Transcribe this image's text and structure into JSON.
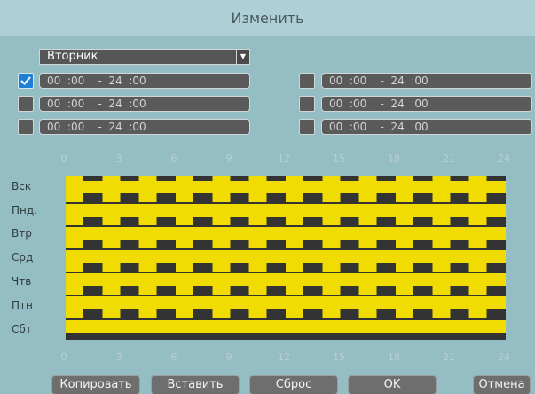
{
  "dialog": {
    "title": "Изменить"
  },
  "day_select": {
    "value": "Вторник"
  },
  "periods": [
    {
      "enabled": true,
      "time": "00  :00    -  24  :00"
    },
    {
      "enabled": false,
      "time": "00  :00    -  24  :00"
    },
    {
      "enabled": false,
      "time": "00  :00    -  24  :00"
    },
    {
      "enabled": false,
      "time": "00  :00    -  24  :00"
    },
    {
      "enabled": false,
      "time": "00  :00    -  24  :00"
    },
    {
      "enabled": false,
      "time": "00  :00    -  24  :00"
    }
  ],
  "timeline": {
    "hours": [
      "0",
      "3",
      "6",
      "9",
      "12",
      "15",
      "18",
      "21",
      "24"
    ],
    "days": [
      "Вск",
      "Пнд.",
      "Втр",
      "Срд",
      "Чтв",
      "Птн",
      "Сбт"
    ]
  },
  "buttons": {
    "copy": "Копировать",
    "paste": "Вставить",
    "reset": "Сброс",
    "ok": "OK",
    "cancel": "Отмена"
  },
  "colors": {
    "background": "#95bdc4",
    "schedule_fill": "#f0dc00",
    "checkbox_active": "#1f7fd4"
  }
}
